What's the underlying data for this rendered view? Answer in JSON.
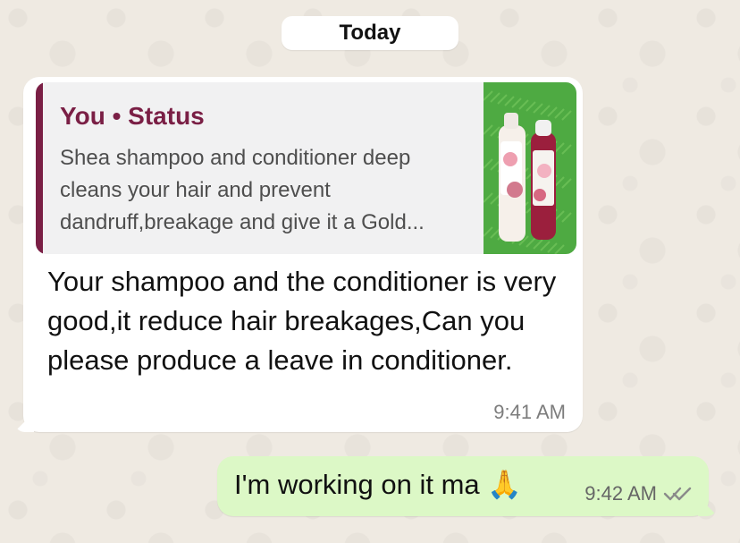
{
  "date_divider": "Today",
  "incoming_message": {
    "reply_preview": {
      "author": "You • Status",
      "text": "Shea shampoo and conditioner deep cleans your hair and prevent dandruff,breakage and give it a Gold..."
    },
    "text": "Your shampoo and the  conditioner is very good,it reduce hair breakages,Can you please produce a leave in conditioner.",
    "time": "9:41 AM"
  },
  "outgoing_message": {
    "text": "I'm working on it ma 🙏",
    "time": "9:42 AM"
  },
  "icons": {
    "read_receipt": "double-check-icon",
    "status_thumbnail": "product-image-icon"
  },
  "colors": {
    "background": "#efeae2",
    "incoming_bubble": "#ffffff",
    "outgoing_bubble": "#dcf8c6",
    "quote_accent": "#7a1f45",
    "read_receipt": "#8a8a8a"
  }
}
